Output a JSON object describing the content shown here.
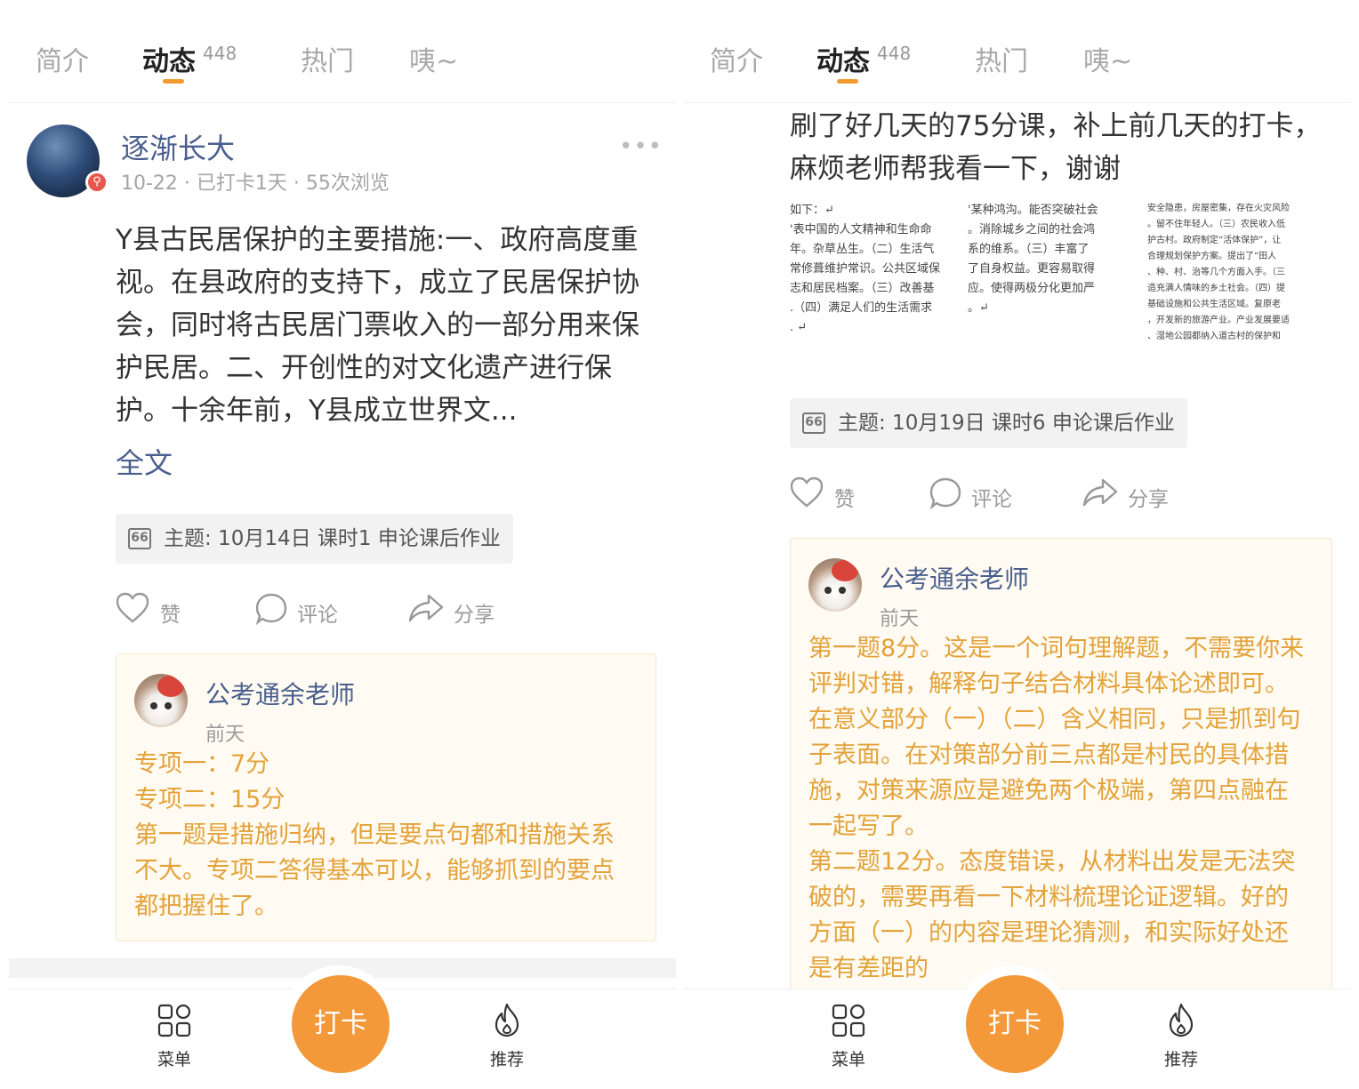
{
  "tabs": [
    {
      "label": "简介"
    },
    {
      "label": "动态",
      "count": "448"
    },
    {
      "label": "热门"
    },
    {
      "label": "咦~"
    }
  ],
  "left_post": {
    "author": "逐渐长大",
    "meta": "10-22 · 已打卡1天 · 55次浏览",
    "more": "•••",
    "body": "Y县古民居保护的主要措施:一、政府高度重视。在县政府的支持下，成立了民居保护协会，同时将古民居门票收入的一部分用来保护民居。二、开创性的对文化遗产进行保护。十余年前，Y县成立世界文...",
    "fulltext": "全文",
    "topic": "主题: 10月14日 课时1 申论课后作业",
    "comment": {
      "teacher": "公考通余老师",
      "when": "前天",
      "lines": [
        "专项一：7分",
        "专项二：15分",
        "第一题是措施归纳，但是要点句都和措施关系不大。专项二答得基本可以，能够抓到的要点都把握住了。"
      ]
    }
  },
  "right_post": {
    "body": "刷了好几天的75分课，补上前几天的打卡，麻烦老师帮我看一下，谢谢",
    "images": [
      {
        "lines": [
          "如下：↵",
          "'表中国的人文精神和生命命",
          "",
          "年。杂草丛生。（二）生活气",
          "常修葺维护常识。公共区域保",
          "志和居民档案。（三）改善基",
          ".（四）满足人们的生活需求",
          ". ↵"
        ]
      },
      {
        "lines": [
          "'某种鸿沟。能否突破社会",
          "",
          "。消除城乡之间的社会鸿",
          "系的维系。（三）丰富了",
          "了自身权益。更容易取得",
          "应。使得两极分化更加严",
          "。↵"
        ]
      },
      {
        "lines": [
          "安全隐患，房屋密集，存在火灾风险",
          "。留不住年轻人。（三）农民收入低",
          "",
          "护古村。政府制定“活体保护”，让",
          "合理规划保护方案。提出了“田人",
          "、种、村、治等几个方面入手。（三",
          "造充满人情味的乡土社会。（四）提",
          "基础设施和公共生活区域。复原老",
          "，开发新的旅游产业。产业发展要适",
          "、湿地公园都纳入道古村的保护和"
        ]
      }
    ],
    "topic": "主题: 10月19日 课时6 申论课后作业",
    "comment": {
      "teacher": "公考通余老师",
      "when": "前天",
      "lines": [
        "第一题8分。这是一个词句理解题，不需要你来评判对错，解释句子结合材料具体论述即可。在意义部分（一）（二）含义相同，只是抓到句子表面。在对策部分前三点都是村民的具体措施，对策来源应是避免两个极端，第四点融在一起写了。",
        "第二题12分。态度错误，从材料出发是无法突破的，需要再看一下材料梳理论证逻辑。好的方面（一）的内容是理论猜测，和实际好处还是有差距的"
      ]
    }
  },
  "actions": {
    "like": "赞",
    "comment": "评论",
    "share": "分享"
  },
  "bottom": {
    "menu": "菜单",
    "checkin": "打卡",
    "recommend": "推荐"
  },
  "colors": {
    "accent": "#f3993a",
    "link": "#4b5f8e",
    "comment_text": "#e3a23a"
  }
}
